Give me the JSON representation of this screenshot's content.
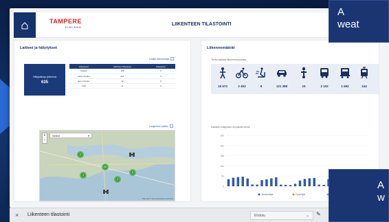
{
  "app": {
    "logo": "TAMPERE",
    "logo_sub": "FINLAND",
    "title": "LIIKENTEEN TILASTOINTI"
  },
  "left_panel": {
    "title": "Laitteet ja hälytykset",
    "link_more": "Lisää merkintöjä",
    "alarm_label": "Hälytystiloja yhteensä",
    "alarm_count": "635",
    "table": {
      "headers": [
        "Hälytykset",
        "Aktiiviset hälytykset",
        "Hälytykset"
      ],
      "rows": [
        [
          "Kaistat",
          "108",
          "0"
        ],
        [
          "Liikennevalot",
          "221",
          "0"
        ],
        [
          "Eco-Counter",
          "12",
          "0"
        ],
        [
          "LAM",
          "11",
          "0"
        ]
      ]
    },
    "map_link": "Laajenna kartta",
    "map_select": "Select",
    "map_zoom_in": "+",
    "map_zoom_out": "−",
    "clusters": [
      "2",
      "4",
      "40",
      "2",
      "5"
    ],
    "map_attribution": "Map data © OpenStreetMap contributors"
  },
  "right_panel": {
    "title": "Liikennemäärät",
    "subtitle": "Tiedot kaikista liikennemuodoista",
    "counts": [
      {
        "icon": "pedestrian-icon",
        "value": "16 673"
      },
      {
        "icon": "bicycle-icon",
        "value": "2 403"
      },
      {
        "icon": "scooter-icon",
        "value": "9"
      },
      {
        "icon": "car-icon",
        "value": "121 388"
      },
      {
        "icon": "motorcycle-icon",
        "value": "15"
      },
      {
        "icon": "bus-icon",
        "value": "2 102"
      },
      {
        "icon": "truck-icon",
        "value": "1 692"
      },
      {
        "icon": "tram-icon",
        "value": "244"
      }
    ],
    "chart_title": "Kaikkien kulkijoiden 30 päivän trendi",
    "legend": [
      "Jalankulkijat",
      "Pyöräilijät",
      "Autot"
    ]
  },
  "banners": {
    "top": [
      "A",
      "weat"
    ],
    "bottom": [
      "A",
      "w"
    ]
  },
  "bottom_bar": {
    "title": "Liikenteen tilastointi",
    "dropdown": "Ehdotu"
  },
  "colors": {
    "navy": "#1b3a7a",
    "brand_red": "#d9262e",
    "cluster_green": "#3a9a3a",
    "bar_blue": "#2e5aa8"
  },
  "chart_data": {
    "type": "bar",
    "title": "Kaikkien kulkijoiden 30 päivän trendi",
    "xlabel": "",
    "ylabel": "",
    "yticks": [
      "0",
      "5k",
      "10k",
      "15k",
      "20k",
      "25k"
    ],
    "ylim": [
      0,
      25000
    ],
    "x": [
      "1",
      "2",
      "3",
      "4",
      "5",
      "6",
      "7",
      "8",
      "9",
      "10",
      "11",
      "12",
      "13",
      "14",
      "15",
      "16",
      "17",
      "18",
      "19",
      "20",
      "21",
      "22",
      "23",
      "24",
      "25",
      "26",
      "27",
      "28",
      "29",
      "30"
    ],
    "values": [
      3500,
      4200,
      4500,
      4700,
      3800,
      900,
      800,
      3000,
      3400,
      3900,
      4400,
      800,
      700,
      600,
      1200,
      2800,
      3600,
      3900,
      4100,
      800,
      700,
      3500,
      4000,
      4200,
      4000,
      3700,
      900,
      800,
      3800,
      4100
    ],
    "grid": true,
    "legend_position": "bottom"
  }
}
